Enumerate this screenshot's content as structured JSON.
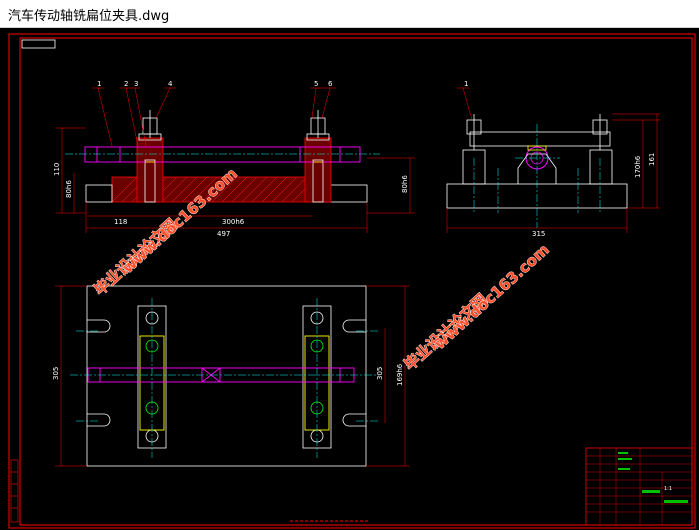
{
  "window": {
    "title": "汽车传动轴铣扁位夹具.dwg"
  },
  "drawing": {
    "front_view": {
      "balloons": [
        "1",
        "2",
        "3",
        "4",
        "5",
        "6"
      ],
      "dims": {
        "height_left": "110",
        "height_sub": "80h6",
        "offset_bottom": "118",
        "span_bottom": "300h6",
        "overall_width": "497",
        "height_right": "80h6"
      }
    },
    "side_view": {
      "balloon": "1",
      "dims": {
        "height_a": "170h6",
        "height_b": "161",
        "width": "315"
      }
    },
    "top_view": {
      "dims": {
        "height_left": "305",
        "height_right_a": "305",
        "height_right_b": "169h6"
      }
    },
    "watermark": {
      "line1": "毕业设计论文网",
      "line2": "www.doc163.com"
    },
    "title_block": {
      "scale": "1:1"
    }
  },
  "colors": {
    "frame": "#ff0000",
    "part": "#ffffff",
    "shaft": "#ff00ff",
    "dimension": "#ff0000",
    "center_line": "#00ffff",
    "hatch": "#ff0000",
    "highlight": "#ffff00",
    "watermark": "#ff4e2a"
  }
}
